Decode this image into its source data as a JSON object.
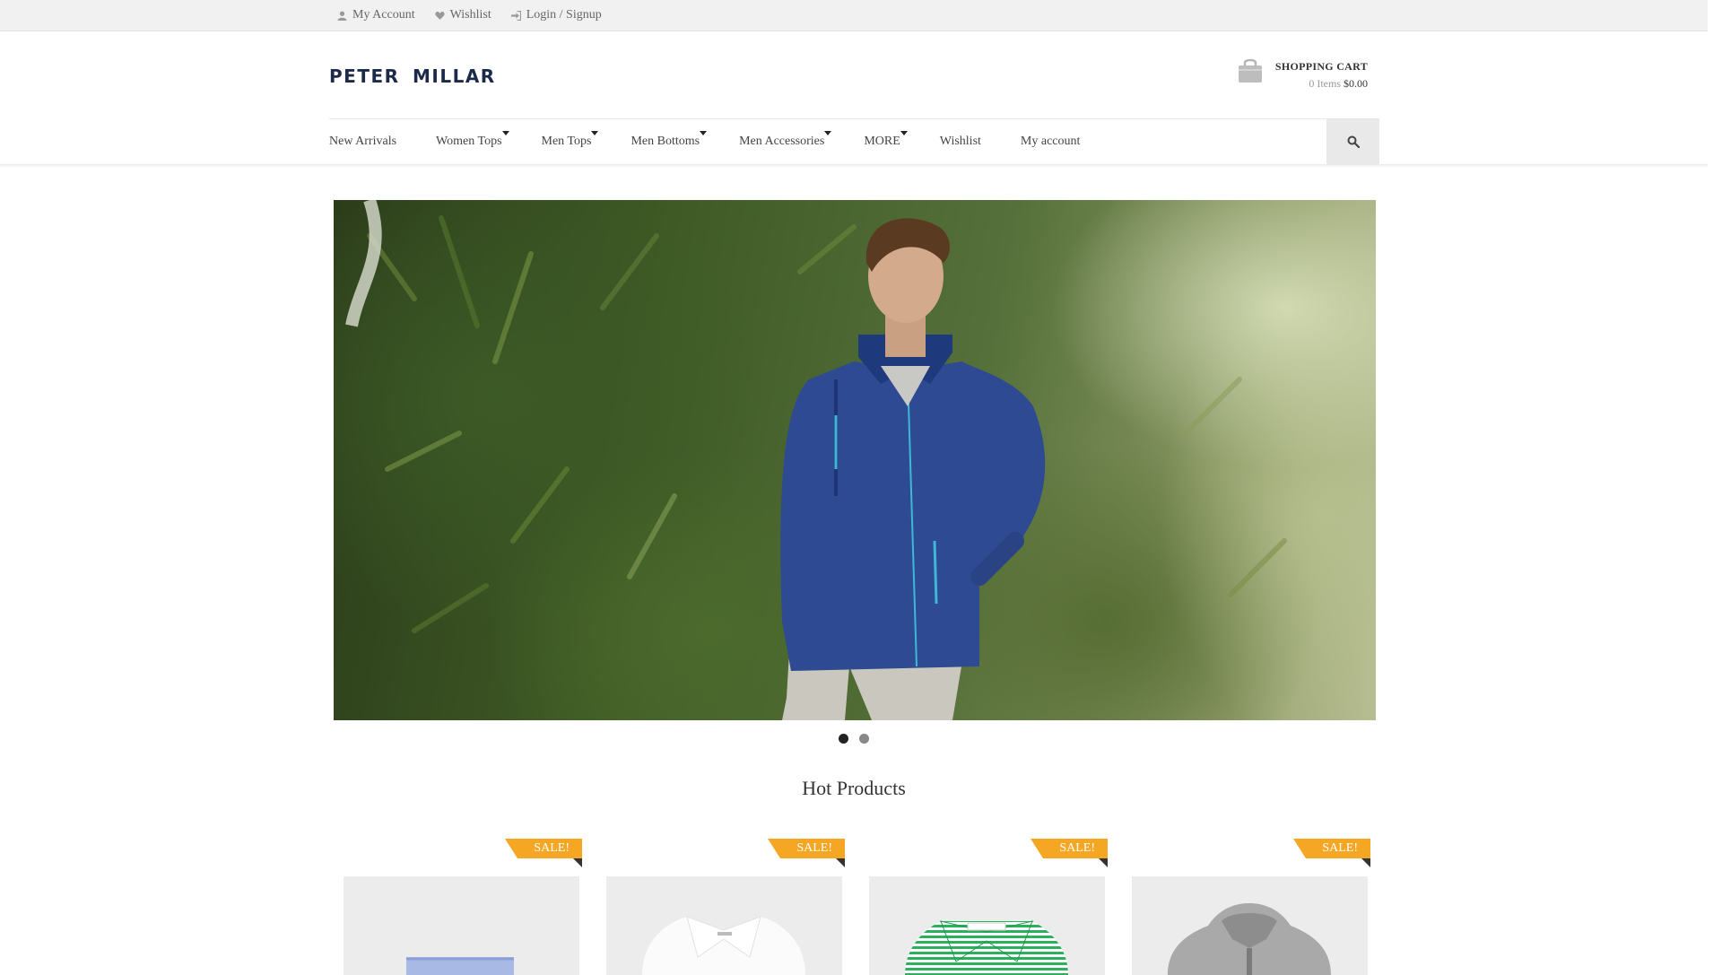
{
  "topbar": {
    "my_account": "My Account",
    "wishlist": "Wishlist",
    "login": "Login / Signup"
  },
  "brand": {
    "logo_text": "PETER MILLAR",
    "color": "#1c2a4a"
  },
  "cart": {
    "title": "SHOPPING CART",
    "items": "0 Items",
    "total": "$0.00"
  },
  "nav": {
    "items": [
      {
        "label": "New Arrivals",
        "has_dropdown": false
      },
      {
        "label": "Women Tops",
        "has_dropdown": true
      },
      {
        "label": "Men Tops",
        "has_dropdown": true
      },
      {
        "label": "Men Bottoms",
        "has_dropdown": true
      },
      {
        "label": "Men Accessories",
        "has_dropdown": true
      },
      {
        "label": "MORE",
        "has_dropdown": true
      },
      {
        "label": "Wishlist",
        "has_dropdown": false
      },
      {
        "label": "My account",
        "has_dropdown": false
      }
    ],
    "search_icon": "search-icon"
  },
  "slider": {
    "slides": 2,
    "active": 1
  },
  "hot_products": {
    "title": "Hot Products",
    "badge": "SALE!",
    "badge_color": "#f5a623",
    "items": [
      {
        "name": "blue-striped-shorts"
      },
      {
        "name": "white-polo"
      },
      {
        "name": "green-striped-polo"
      },
      {
        "name": "grey-hoodie"
      }
    ]
  }
}
